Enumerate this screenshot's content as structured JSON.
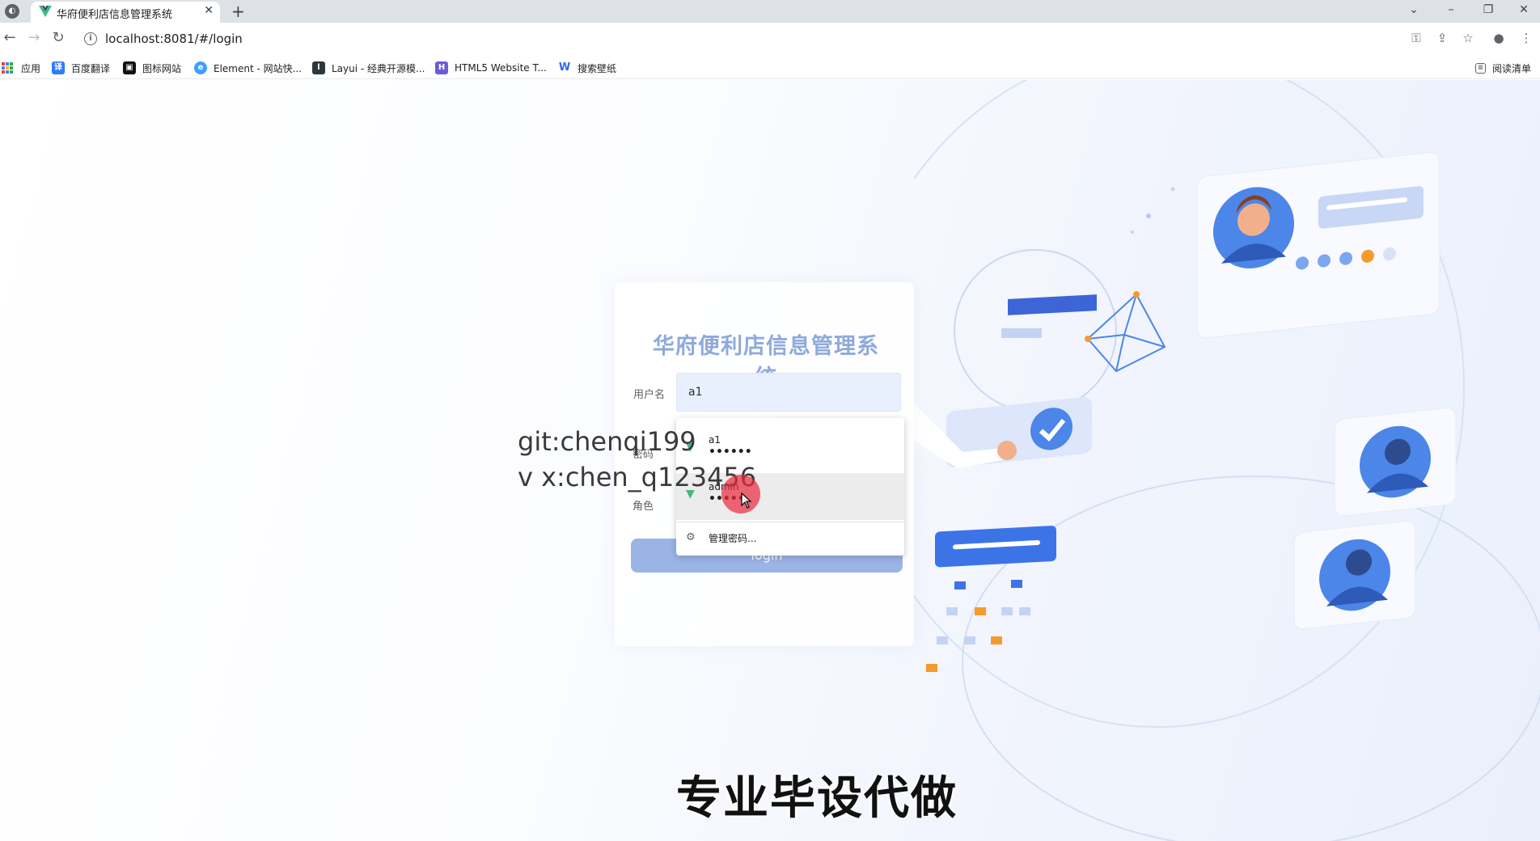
{
  "browser": {
    "tab_title": "华府便利店信息管理系统",
    "tab_close": "✕",
    "new_tab": "+",
    "url": "localhost:8081/#/login",
    "window_controls": [
      "⌄",
      "–",
      "❐",
      "✕"
    ]
  },
  "bookmarks": [
    {
      "label": "应用",
      "icon": "apps-grid-icon"
    },
    {
      "label": "百度翻译",
      "icon": "baidu-translate-icon",
      "color": "#2f7cf6"
    },
    {
      "label": "图标网站",
      "icon": "icon-site-icon",
      "color": "#111111"
    },
    {
      "label": "Element - 网站快...",
      "icon": "element-icon",
      "color": "#409eff"
    },
    {
      "label": "Layui - 经典开源模...",
      "icon": "layui-icon",
      "color": "#2f363c"
    },
    {
      "label": "HTML5 Website T...",
      "icon": "html5-template-icon",
      "color": "#6b5bd6"
    },
    {
      "label": "搜索壁纸",
      "icon": "wallpaper-search-icon",
      "color": "#2d6cdf"
    }
  ],
  "reading_list": "阅读清单",
  "login": {
    "title": "华府便利店信息管理系统",
    "username_label": "用户名",
    "username_value": "a1",
    "password_label": "密码",
    "role_label": "角色",
    "login_button": "login"
  },
  "autofill": {
    "items": [
      {
        "username": "a1",
        "password": "••••••"
      },
      {
        "username": "admin",
        "password": "•••••"
      }
    ],
    "manage_label": "管理密码..."
  },
  "watermark": {
    "git": "git:chenqi199",
    "vx": "v x:chen_q123456",
    "bottom": "专业毕设代做"
  },
  "colors": {
    "title": "#8fa9dc",
    "button": "#9ab4e6",
    "input_bg": "#e8f0fe",
    "illustration_purple": "#7b7be8",
    "illustration_blue": "#3f7fe8"
  }
}
